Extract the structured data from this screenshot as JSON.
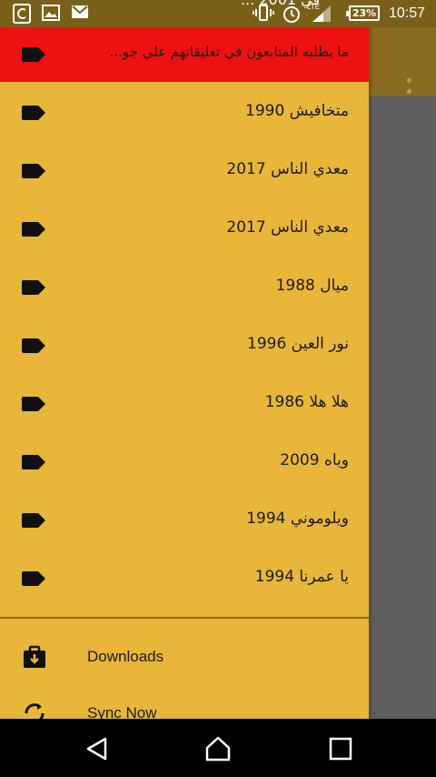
{
  "status_bar": {
    "partial_top_text": "... في 2001",
    "network_type": "LTE",
    "battery_percent": "23%",
    "time": "10:57"
  },
  "drawer": {
    "header_title": "ما يطلبه المتابعون في تعليقاتهم علي جو...",
    "items": [
      {
        "label": "متخافيش 1990"
      },
      {
        "label": "معدي الناس 2017"
      },
      {
        "label": "معدي الناس 2017"
      },
      {
        "label": "ميال 1988"
      },
      {
        "label": "نور العين 1996"
      },
      {
        "label": "هلا هلا 1986"
      },
      {
        "label": "وياه 2009"
      },
      {
        "label": "ويلوموني 1994"
      },
      {
        "label": "يا عمرنا 1994"
      }
    ],
    "actions": [
      {
        "label": "Downloads",
        "icon": "download-briefcase-icon"
      },
      {
        "label": "Sync Now",
        "icon": "sync-icon"
      }
    ]
  },
  "colors": {
    "drawer_bg": "#e8b73a",
    "header_bg": "#ee1111",
    "toolbar_bg": "#8a6a1e",
    "scrim": "#5e5e5e"
  },
  "nav_bar": {
    "back_icon": "back-triangle-icon",
    "home_icon": "home-icon",
    "recents_icon": "recents-square-icon"
  }
}
